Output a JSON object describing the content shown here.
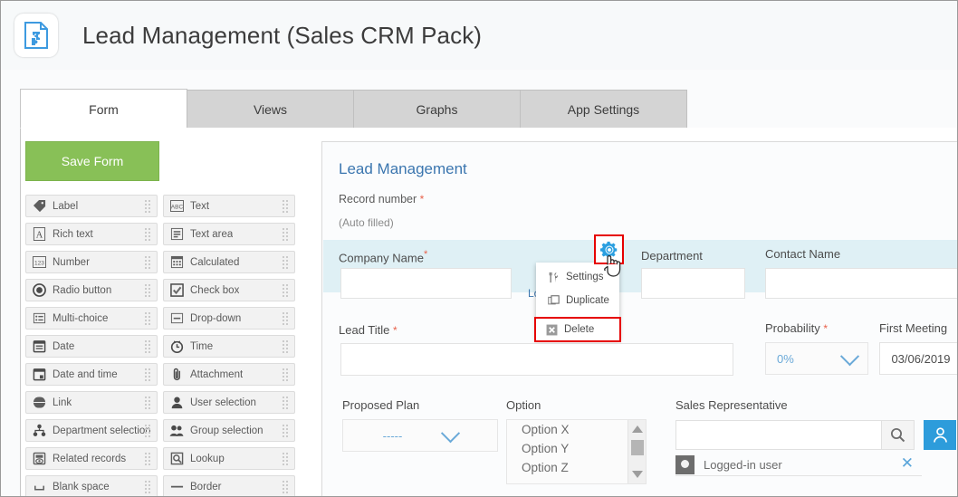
{
  "header": {
    "app_icon": "document-puzzle-icon",
    "title": "Lead Management (Sales CRM Pack)"
  },
  "tabs": [
    {
      "label": "Form",
      "active": true
    },
    {
      "label": "Views",
      "active": false
    },
    {
      "label": "Graphs",
      "active": false
    },
    {
      "label": "App Settings",
      "active": false
    }
  ],
  "toolbar": {
    "save_label": "Save Form",
    "save_color": "#88c057"
  },
  "palette": {
    "items": [
      {
        "label": "Label",
        "icon": "tag-icon"
      },
      {
        "label": "Text",
        "icon": "abc-icon"
      },
      {
        "label": "Rich text",
        "icon": "letter-a-icon"
      },
      {
        "label": "Text area",
        "icon": "text-lines-icon"
      },
      {
        "label": "Number",
        "icon": "123-icon"
      },
      {
        "label": "Calculated",
        "icon": "calculator-icon"
      },
      {
        "label": "Radio button",
        "icon": "radio-icon"
      },
      {
        "label": "Check box",
        "icon": "checkbox-icon"
      },
      {
        "label": "Multi-choice",
        "icon": "list-icon"
      },
      {
        "label": "Drop-down",
        "icon": "dropdown-icon"
      },
      {
        "label": "Date",
        "icon": "calendar-icon"
      },
      {
        "label": "Time",
        "icon": "clock-icon"
      },
      {
        "label": "Date and time",
        "icon": "calendar-clock-icon"
      },
      {
        "label": "Attachment",
        "icon": "paperclip-icon"
      },
      {
        "label": "Link",
        "icon": "globe-icon"
      },
      {
        "label": "User selection",
        "icon": "user-icon"
      },
      {
        "label": "Department selection",
        "icon": "org-tree-icon"
      },
      {
        "label": "Group selection",
        "icon": "users-icon"
      },
      {
        "label": "Related records",
        "icon": "related-records-icon"
      },
      {
        "label": "Lookup",
        "icon": "magnifier-box-icon"
      },
      {
        "label": "Blank space",
        "icon": "blank-space-icon"
      },
      {
        "label": "Border",
        "icon": "horizontal-line-icon"
      }
    ]
  },
  "form": {
    "title": "Lead Management",
    "record_number_label": "Record number",
    "record_number_required": "*",
    "auto_filled": "(Auto filled)",
    "fields": {
      "company_name": {
        "label": "Company Name",
        "required": "*",
        "value": ""
      },
      "lookup_link": "Lo",
      "department": {
        "label": "Department",
        "value": ""
      },
      "contact_name": {
        "label": "Contact Name",
        "value": ""
      },
      "lead_title": {
        "label": "Lead Title",
        "required": "*",
        "value": ""
      },
      "probability": {
        "label": "Probability",
        "required": "*",
        "value": "0%"
      },
      "first_meeting": {
        "label": "First Meeting",
        "value": "03/06/2019"
      },
      "proposed_plan": {
        "label": "Proposed Plan",
        "value": "-----"
      },
      "option": {
        "label": "Option",
        "items": [
          "Option X",
          "Option Y",
          "Option Z"
        ]
      },
      "sales_representative": {
        "label": "Sales Representative",
        "value": "",
        "search_icon": "magnifier-icon",
        "user_picker_icon": "user-icon",
        "chip_label": "Logged-in user",
        "chip_remove_icon": "close-icon"
      }
    }
  },
  "context_menu": {
    "gear_icon": "gear-icon",
    "cursor": "pointer-hand-cursor",
    "highlight_color": "#e60000",
    "items": [
      {
        "label": "Settings",
        "icon": "tools-icon",
        "highlighted": false
      },
      {
        "label": "Duplicate",
        "icon": "copy-icon",
        "highlighted": false
      },
      {
        "label": "Delete",
        "icon": "close-box-icon",
        "highlighted": true
      }
    ]
  }
}
